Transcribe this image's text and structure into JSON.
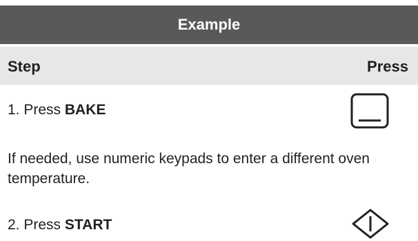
{
  "banner": {
    "title": "Example"
  },
  "columns": {
    "step": "Step",
    "press": "Press"
  },
  "steps": [
    {
      "prefix": "1.  Press ",
      "key": "BAKE",
      "icon": "bake-key-icon"
    },
    {
      "prefix": "2.  Press ",
      "key": "START",
      "icon": "start-key-icon"
    }
  ],
  "note": "If needed, use numeric keypads to enter a different oven temperature."
}
